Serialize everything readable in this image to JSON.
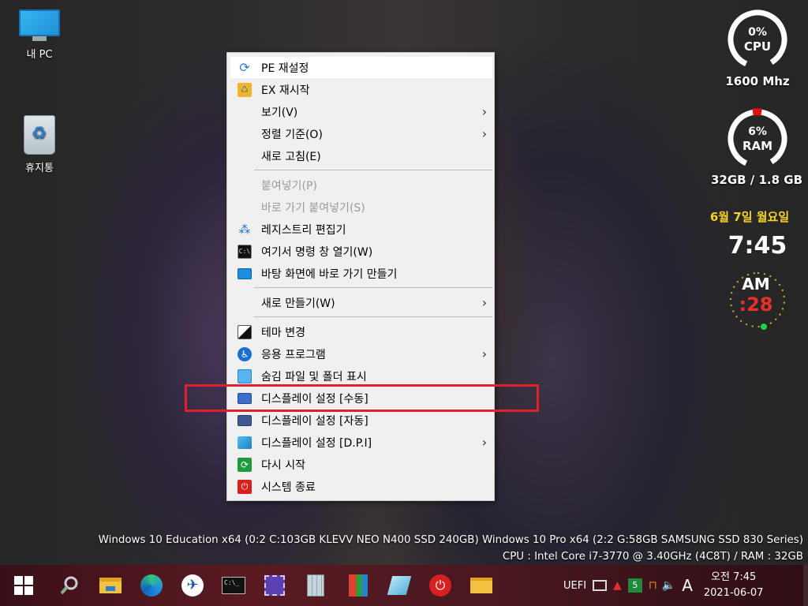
{
  "desktop": {
    "icons": [
      {
        "label": "내 PC",
        "icon": "this-pc-icon"
      },
      {
        "label": "휴지통",
        "icon": "recycle-bin-icon"
      }
    ]
  },
  "context_menu": {
    "items": [
      {
        "label": "PE 재설정",
        "icon": "refresh-icon"
      },
      {
        "label": "EX 재시작",
        "icon": "explorer-restart-icon"
      },
      {
        "label": "보기(V)",
        "submenu": true
      },
      {
        "label": "정렬 기준(O)",
        "submenu": true
      },
      {
        "label": "새로 고침(E)"
      },
      {
        "label": "붙여넣기(P)",
        "disabled": true
      },
      {
        "label": "바로 가기 붙여넣기(S)",
        "disabled": true
      },
      {
        "label": "레지스트리 편집기",
        "icon": "registry-icon"
      },
      {
        "label": "여기서 명령 창 열기(W)",
        "icon": "cmd-icon"
      },
      {
        "label": "바탕 화면에 바로 가기 만들기",
        "icon": "shortcut-icon"
      },
      {
        "label": "새로 만들기(W)",
        "submenu": true
      },
      {
        "label": "테마 변경",
        "icon": "theme-icon"
      },
      {
        "label": "응용 프로그램",
        "icon": "accessibility-icon",
        "submenu": true
      },
      {
        "label": "숨김 파일 및 폴더 표시",
        "icon": "hidden-files-icon"
      },
      {
        "label": "디스플레이 설정 [수동]",
        "icon": "display-manual-icon",
        "highlighted": true
      },
      {
        "label": "디스플레이 설정 [자동]",
        "icon": "display-auto-icon"
      },
      {
        "label": "디스플레이 설정 [D.P.I]",
        "icon": "display-dpi-icon",
        "submenu": true
      },
      {
        "label": "다시 시작",
        "icon": "restart-icon"
      },
      {
        "label": "시스템 종료",
        "icon": "shutdown-icon"
      }
    ],
    "highlight_color": "#e0202a"
  },
  "widgets": {
    "cpu": {
      "percent_label": "0%",
      "name": "CPU",
      "value": 0,
      "freq": "1600 Mhz"
    },
    "ram": {
      "percent_label": "6%",
      "name": "RAM",
      "value": 6,
      "usage": "32GB / 1.8 GB"
    },
    "date": "6월 7일 월요일",
    "time": "7:45",
    "ampm": "AM",
    "seconds": ":28"
  },
  "sysinfo": {
    "line1": "Windows 10 Education x64 (0:2 C:103GB KLEVV NEO N400 SSD 240GB) Windows 10 Pro x64 (2:2 G:58GB SAMSUNG SSD 830 Series)",
    "line2": "CPU : Intel Core i7-3770 @ 3.40GHz (4C8T) / RAM : 32GB"
  },
  "taskbar": {
    "apps": [
      "start-icon",
      "search-icon",
      "file-explorer-icon",
      "edge-icon",
      "bird-app-icon",
      "cmd-icon",
      "cpu-z-icon",
      "calculator-icon",
      "installer-icon",
      "notepad-icon",
      "power-icon",
      "folder-icon"
    ],
    "tray": {
      "uefi": "UEFI",
      "badge": "5",
      "ime": "A",
      "time": "오전 7:45",
      "date": "2021-06-07"
    }
  },
  "colors": {
    "cpu_ring": "#ffffff",
    "ram_accent": "#e01010",
    "date": "#f5d12a",
    "seconds": "#e8302a"
  }
}
